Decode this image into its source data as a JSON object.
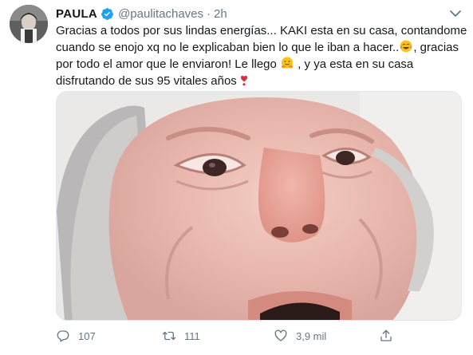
{
  "tweet": {
    "author_name": "PAULA",
    "handle": "@paulitachaves",
    "separator": "·",
    "time": "2h",
    "text_lines": [
      "Gracias a todos por sus lindas energías... KAKI esta en su casa, contandome",
      "cuando se enojo xq no le explicaban bien lo que le iban a hacer..",
      ", gracias",
      "por todo el amor que le enviaron! Le llego",
      " , y ya esta en su casa",
      "disfrutando de sus 95 vitales años"
    ],
    "emojis": {
      "laughing": "face-with-tears-of-joy-icon",
      "hug": "hugging-face-icon",
      "heart": "heavy-heart-exclamation-icon"
    }
  },
  "actions": {
    "reply_count": "107",
    "retweet_count": "111",
    "like_count": "3,9 mil"
  },
  "colors": {
    "text": "#14171a",
    "secondary": "#657786",
    "verified": "#1da1f2",
    "divider": "#e1e8ed"
  }
}
